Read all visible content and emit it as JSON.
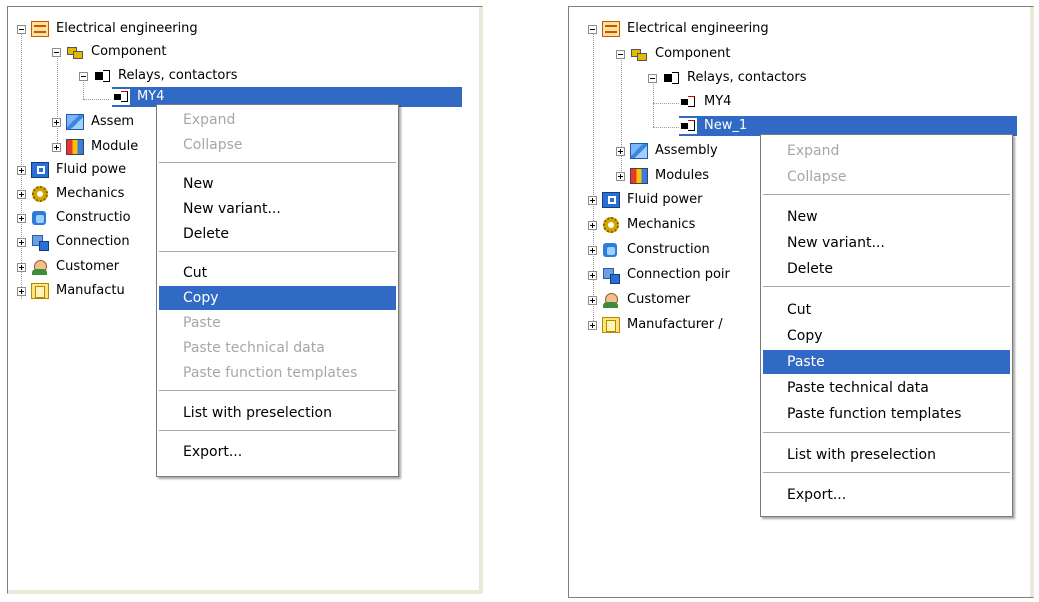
{
  "tree_labels": {
    "electrical_engineering": "Electrical engineering",
    "component": "Component",
    "relays_contactors": "Relays, contactors",
    "my4": "MY4",
    "new_1": "New_1",
    "assembly": "Assembly",
    "assembly_truncated": "Assem",
    "modules": "Modules",
    "modules_truncated": "Module",
    "fluid_power": "Fluid power",
    "fluid_power_truncated": "Fluid powe",
    "mechanics": "Mechanics",
    "construction": "Construction",
    "construction_truncated": "Constructio",
    "connection_points": "Connection poir",
    "connection_points_truncated": "Connection",
    "customer": "Customer",
    "manufacturer": "Manufacturer /",
    "manufacturer_truncated": "Manufactu"
  },
  "left_screen": {
    "selected_node": "MY4",
    "context_menu": {
      "expand": "Expand",
      "collapse": "Collapse",
      "new": "New",
      "new_variant": "New variant...",
      "delete": "Delete",
      "cut": "Cut",
      "copy": "Copy",
      "paste": "Paste",
      "paste_technical_data": "Paste technical data",
      "paste_function_templates": "Paste function templates",
      "list_with_preselection": "List with preselection",
      "export": "Export..."
    },
    "highlighted_item": "Copy",
    "disabled_items": [
      "Expand",
      "Collapse",
      "Paste",
      "Paste technical data",
      "Paste function templates"
    ]
  },
  "right_screen": {
    "selected_node": "New_1",
    "context_menu": {
      "expand": "Expand",
      "collapse": "Collapse",
      "new": "New",
      "new_variant": "New variant...",
      "delete": "Delete",
      "cut": "Cut",
      "copy": "Copy",
      "paste": "Paste",
      "paste_technical_data": "Paste technical data",
      "paste_function_templates": "Paste function templates",
      "list_with_preselection": "List with preselection",
      "export": "Export..."
    },
    "highlighted_item": "Paste",
    "disabled_items": [
      "Expand",
      "Collapse"
    ]
  },
  "colors": {
    "selection": "#316ac5",
    "disabled_text": "#a7a6aa",
    "panel_border": "#7f7f7f"
  }
}
